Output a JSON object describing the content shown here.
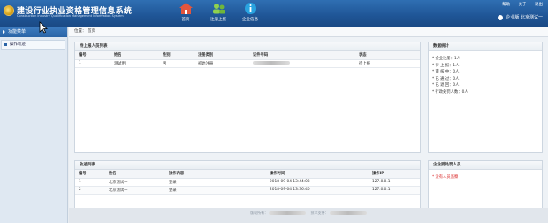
{
  "header": {
    "title": "建设行业执业资格管理信息系统",
    "subtitle": "Construction Industry Qualification Management Information System",
    "nav": [
      {
        "label": "首页",
        "icon": "home-icon"
      },
      {
        "label": "注册上报",
        "icon": "users-icon"
      },
      {
        "label": "企业信息",
        "icon": "info-icon"
      }
    ],
    "top_links": [
      "帮助",
      "关于",
      "退出"
    ],
    "user": "企业版  北京测试一"
  },
  "sidebar": {
    "heading": "功能菜单",
    "items": [
      {
        "label": "操作轨迹"
      }
    ]
  },
  "breadcrumb": "位置： 首页",
  "pending": {
    "title": "待上报人员列表",
    "columns": [
      "编号",
      "姓名",
      "性别",
      "注册类别",
      "证件号码",
      "状态"
    ],
    "rows": [
      [
        "1",
        "测试用",
        "男",
        "初始注册",
        "",
        "待上报"
      ]
    ]
  },
  "stats": {
    "title": "数据统计",
    "lines": [
      "* 企业注册：1人",
      "* 待 上 报：1人",
      "* 审   核 中：0人",
      "* 已   通   过：0人",
      "* 已   退   回：0人",
      "* 行政处罚人数：0人"
    ]
  },
  "track": {
    "title": "轨迹列表",
    "columns": [
      "编号",
      "姓名",
      "操作内容",
      "操作时间",
      "操作IP"
    ],
    "rows": [
      [
        "1",
        "北京测试一",
        "登录",
        "2018-09-04 13:44:03",
        "127.0.0.1"
      ],
      [
        "2",
        "北京测试一",
        "登录",
        "2018-09-04 13:36:40",
        "127.0.0.1"
      ]
    ]
  },
  "penalty": {
    "title": "企业受处罚人员",
    "message": "* 没有人员监察"
  },
  "footer": {
    "left": "版权所有：",
    "tech": "技术支持："
  },
  "colors": {
    "header": "#1f5596",
    "warning": "#d82020"
  }
}
